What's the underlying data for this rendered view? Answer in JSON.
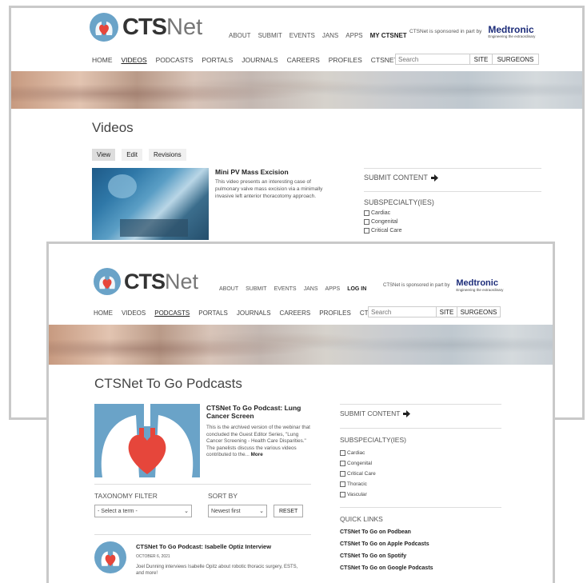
{
  "colors": {
    "logo_blue": "#6aa3c8",
    "heart_red": "#e6463b",
    "medtronic_navy": "#1d2d7a"
  },
  "brand": {
    "cts": "CTS",
    "net": "Net"
  },
  "top_nav": [
    "ABOUT",
    "SUBMIT",
    "EVENTS",
    "JANS",
    "APPS"
  ],
  "sponsor": {
    "text": "CTSNet is sponsored in part by",
    "name": "Medtronic",
    "tagline": "Engineering the extraordinary"
  },
  "main_nav": [
    "HOME",
    "VIDEOS",
    "PODCASTS",
    "PORTALS",
    "JOURNALS",
    "CAREERS",
    "PROFILES",
    "CTSNET GLOBAL"
  ],
  "search": {
    "placeholder": "Search",
    "site": "SITE",
    "surgeons": "SURGEONS"
  },
  "window1": {
    "user_link": "MY CTSNET",
    "page_title": "Videos",
    "tabs": [
      "View",
      "Edit",
      "Revisions"
    ],
    "video": {
      "title": "Mini PV Mass Excision",
      "desc": "This video presents an interesting case of pulmonary valve mass excision via a minimally invasive left anterior thoracotomy approach."
    },
    "sidebar": {
      "submit": "SUBMIT CONTENT",
      "subspecialty": "SUBSPECIALTY(IES)",
      "options": [
        "Cardiac",
        "Congenital",
        "Critical Care"
      ]
    }
  },
  "window2": {
    "user_link": "LOG IN",
    "page_title": "CTSNet To Go Podcasts",
    "featured": {
      "title": "CTSNet To Go Podcast: Lung Cancer Screen",
      "desc": "This is the archived version of the webinar that concluded the Guest Editor Series, \"Lung Cancer Screening - Health Care Disparities.\" The panelists discuss the various videos contributed to the...",
      "more": "More"
    },
    "filters": {
      "taxonomy_label": "TAXONOMY FILTER",
      "taxonomy_value": "- Select a term -",
      "sort_label": "SORT BY",
      "sort_value": "Newest first",
      "reset": "RESET"
    },
    "item": {
      "title": "CTSNet To Go Podcast: Isabelle Optiz Interview",
      "date": "OCTOBER 6, 2021",
      "desc": "Joel Dunning interviews Isabelle Opitz about robotic thoracic surgery, ESTS, and more!"
    },
    "sidebar": {
      "submit": "SUBMIT CONTENT",
      "subspecialty": "SUBSPECIALTY(IES)",
      "options": [
        "Cardiac",
        "Congenital",
        "Critical Care",
        "Thoracic",
        "Vascular"
      ],
      "quick_links_title": "QUICK LINKS",
      "quick_links": [
        "CTSNet To Go on Podbean",
        "CTSNet To Go on Apple Podcasts",
        "CTSNet To Go on Spotify",
        "CTSNet To Go on Google Podcasts"
      ]
    }
  }
}
